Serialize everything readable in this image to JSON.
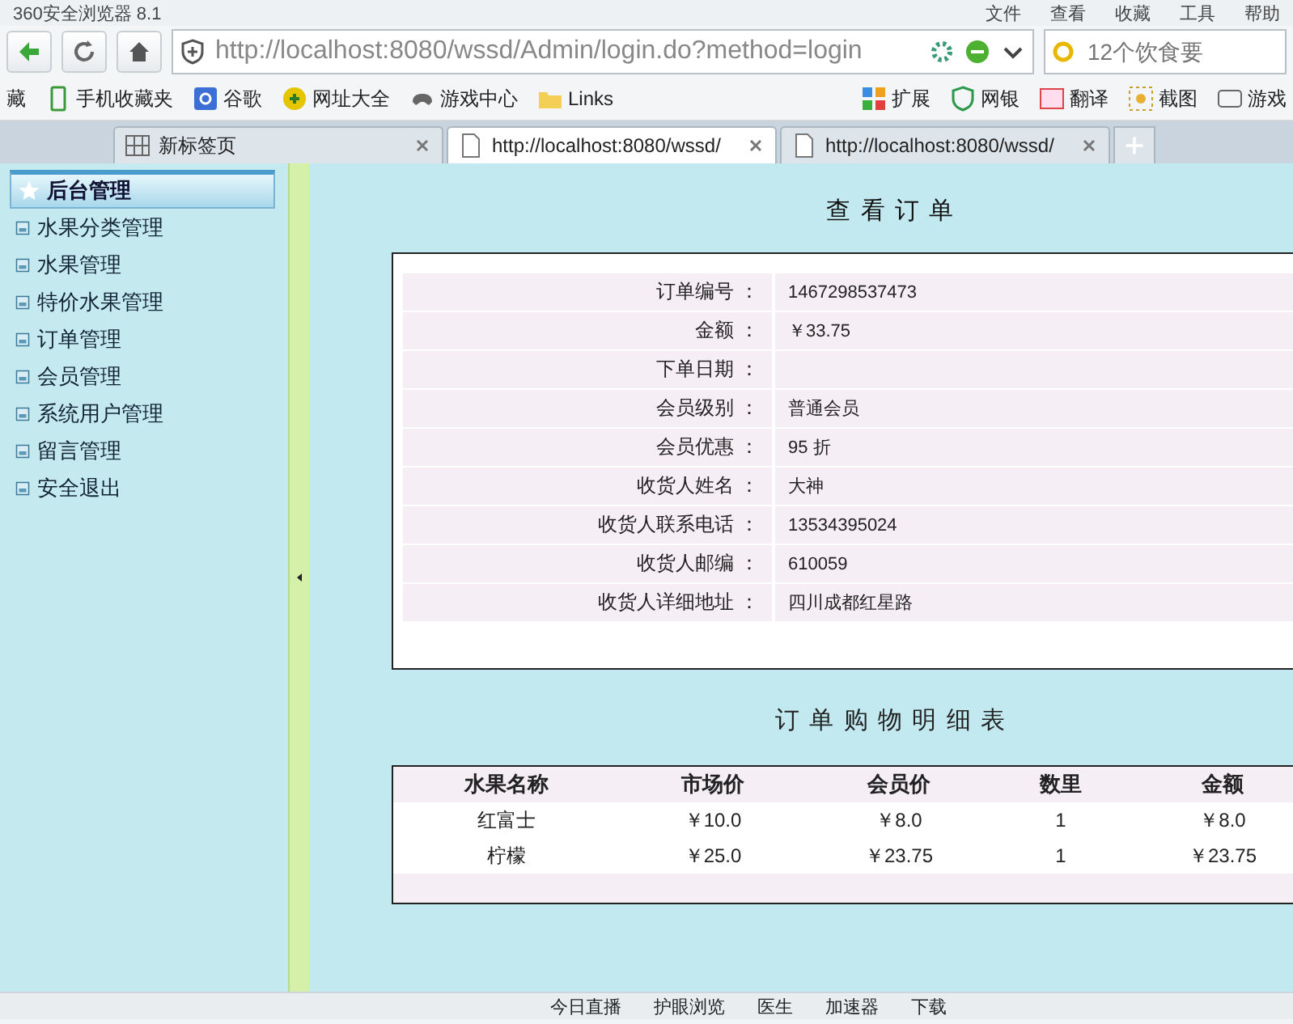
{
  "window": {
    "title": "360安全浏览器 8.1",
    "menu": [
      "文件",
      "查看",
      "收藏",
      "工具",
      "帮助"
    ]
  },
  "address_bar": {
    "url": "http://localhost:8080/wssd/Admin/login.do?method=login",
    "search_placeholder": "12个饮食要"
  },
  "bookmarks": [
    "藏",
    "手机收藏夹",
    "谷歌",
    "网址大全",
    "游戏中心",
    "Links"
  ],
  "toolbar": [
    "扩展",
    "网银",
    "翻译",
    "截图",
    "游戏"
  ],
  "tabs": [
    {
      "label": "新标签页",
      "selected": false
    },
    {
      "label": "http://localhost:8080/wssd/",
      "selected": true
    },
    {
      "label": "http://localhost:8080/wssd/",
      "selected": false
    }
  ],
  "sidebar": {
    "header": "后台管理",
    "items": [
      "水果分类管理",
      "水果管理",
      "特价水果管理",
      "订单管理",
      "会员管理",
      "系统用户管理",
      "留言管理",
      "安全退出"
    ]
  },
  "order": {
    "title": "查 看 订 单",
    "fields": [
      {
        "label": "订单编号 ：",
        "value": "1467298537473"
      },
      {
        "label": "金额 ：",
        "value": "￥33.75"
      },
      {
        "label": "下单日期 ："
      },
      {
        "label": "会员级别 ：",
        "value": "普通会员"
      },
      {
        "label": "会员优惠 ：",
        "value": "95 折"
      },
      {
        "label": "收货人姓名 ：",
        "value": "大神"
      },
      {
        "label": "收货人联系电话 ：",
        "value": "13534395024"
      },
      {
        "label": "收货人邮编 ：",
        "value": "610059"
      },
      {
        "label": "收货人详细地址 ：",
        "value": "四川成都红星路"
      }
    ]
  },
  "details": {
    "title": "订 单 购 物 明 细 表",
    "columns": [
      "水果名称",
      "市场价",
      "会员价",
      "数里",
      "金额"
    ],
    "rows": [
      [
        "红富士",
        "￥10.0",
        "￥8.0",
        "1",
        "￥8.0"
      ],
      [
        "柠檬",
        "￥25.0",
        "￥23.75",
        "1",
        "￥23.75"
      ]
    ]
  },
  "status_bar": [
    "今日直播",
    "护眼浏览",
    "医生",
    "加速器",
    "下载"
  ]
}
